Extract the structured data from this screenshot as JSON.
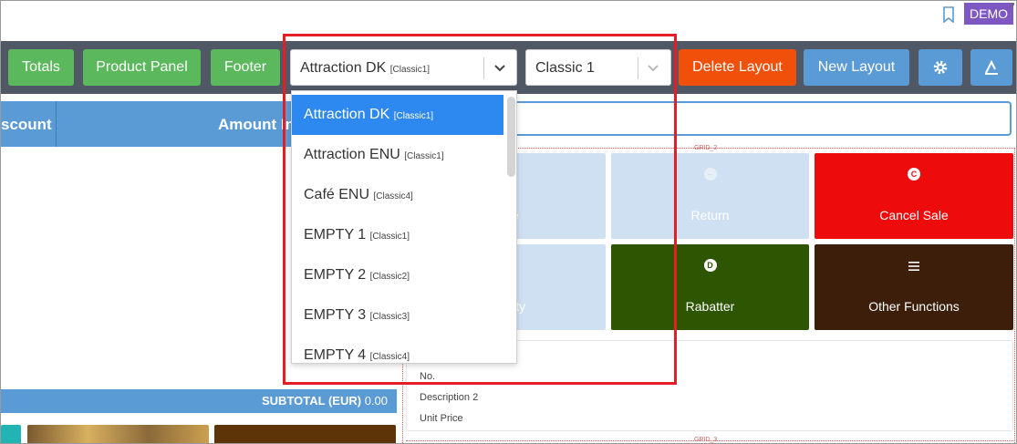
{
  "topbar": {
    "demo_badge": "DEMO"
  },
  "toolbar": {
    "totals_label": "Totals",
    "product_panel_label": "Product Panel",
    "footer_label": "Footer",
    "layout_select": {
      "value_main": "Attraction DK",
      "value_tag": "[Classic1]"
    },
    "theme_select": {
      "value": "Classic 1"
    },
    "delete_layout_label": "Delete Layout",
    "new_layout_label": "New Layout",
    "colors": {
      "green": "#5cb85c",
      "orange": "#f0500a",
      "blue": "#5b9bd5",
      "bar": "#505866"
    }
  },
  "dropdown": {
    "items": [
      {
        "name": "Attraction DK",
        "tag": "[Classic1]",
        "selected": true
      },
      {
        "name": "Attraction ENU",
        "tag": "[Classic1]"
      },
      {
        "name": "Café ENU",
        "tag": "[Classic4]"
      },
      {
        "name": "EMPTY 1",
        "tag": "[Classic1]"
      },
      {
        "name": "EMPTY 2",
        "tag": "[Classic2]"
      },
      {
        "name": "EMPTY 3",
        "tag": "[Classic3]"
      },
      {
        "name": "EMPTY 4",
        "tag": "[Classic4]"
      }
    ]
  },
  "sale_table": {
    "col_discount": "scount",
    "col_amount": "Amount In"
  },
  "grid_labels": {
    "grid2": "GRID_2",
    "grid3": "GRID_3"
  },
  "tiles": {
    "line": {
      "label": "Line"
    },
    "return": {
      "label": "Return",
      "icon": "minus-circle-icon"
    },
    "cancel_sale": {
      "label": "Cancel Sale",
      "icon": "c-circle-icon",
      "icon_letter": "C",
      "color": "#ee0b0b"
    },
    "quantity": {
      "label": "uantity"
    },
    "rabatter": {
      "label": "Rabatter",
      "icon": "d-circle-icon",
      "icon_letter": "D",
      "color": "#2e5502"
    },
    "other_functions": {
      "label": "Other Functions",
      "icon": "menu-icon",
      "color": "#3c1e0a"
    }
  },
  "info_panel": {
    "row1": "No.",
    "row2": "Description 2",
    "row3": "Unit Price"
  },
  "subtotal": {
    "label": "SUBTOTAL (EUR)",
    "value": "0.00"
  }
}
